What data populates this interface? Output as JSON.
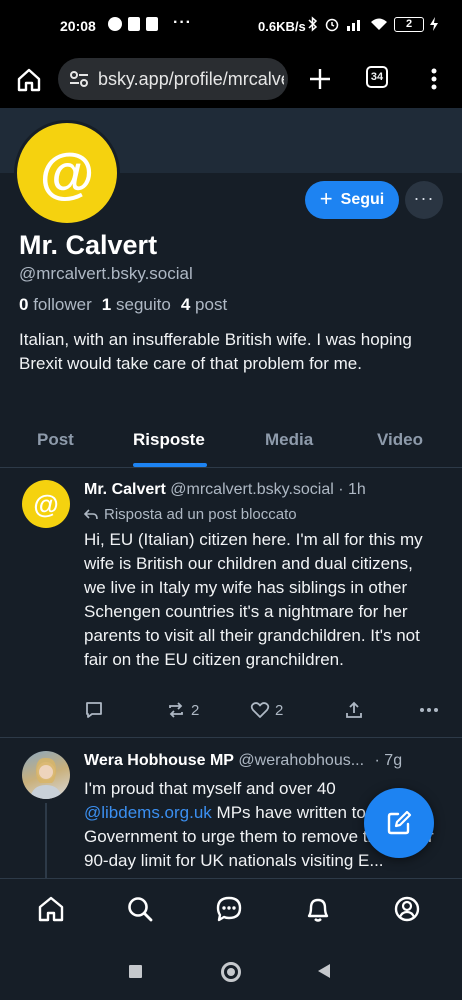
{
  "status_bar": {
    "time": "20:08",
    "overflow": "···",
    "net_speed": "0.6KB/s",
    "battery": "2"
  },
  "browser": {
    "url": "bsky.app/profile/mrcalvert.bsky.social",
    "tab_count": "34"
  },
  "profile": {
    "avatar_glyph": "@",
    "display_name": "Mr. Calvert",
    "handle": "@mrcalvert.bsky.social",
    "followers_count": "0",
    "followers_label": "follower",
    "following_count": "1",
    "following_label": "seguito",
    "posts_count": "4",
    "posts_label": "post",
    "bio": "Italian, with an insufferable British wife. I was hoping Brexit would take care of that problem for me.",
    "follow_label": "Segui",
    "more_label": "···"
  },
  "tabs": [
    {
      "label": "Post"
    },
    {
      "label": "Risposte",
      "active": true
    },
    {
      "label": "Media"
    },
    {
      "label": "Video"
    }
  ],
  "posts": [
    {
      "author": "Mr. Calvert",
      "handle": "@mrcalvert.bsky.social",
      "time": "· 1h",
      "reply_note": "Risposta ad un post bloccato",
      "text": "Hi, EU (Italian) citizen here. I'm all for this my wife is British our children and dual citizens, we live in Italy my wife has siblings in other Schengen countries it's a nightmare for her parents to visit all their grandchildren. It's not fair on the EU citizen granchildren.",
      "reposts": "2",
      "likes": "2"
    },
    {
      "author": "Wera Hobhouse MP",
      "handle": "@werahobhous...",
      "time": "· 7g",
      "text_before": "I'm proud that myself and over 40 ",
      "mention": "@libdems.org.uk",
      "text_after": " MPs have written to the Government to urge them to remove the unfair 90-day limit for UK nationals visiting E..."
    }
  ],
  "colors": {
    "background": "#161e27",
    "accent": "#1d83f2",
    "avatar_yellow": "#f5d20f"
  },
  "icons": {
    "home": "home-icon",
    "search": "search-icon",
    "chat": "chat-icon",
    "notifications": "bell-icon",
    "profile": "profile-icon",
    "compose": "compose-icon"
  }
}
